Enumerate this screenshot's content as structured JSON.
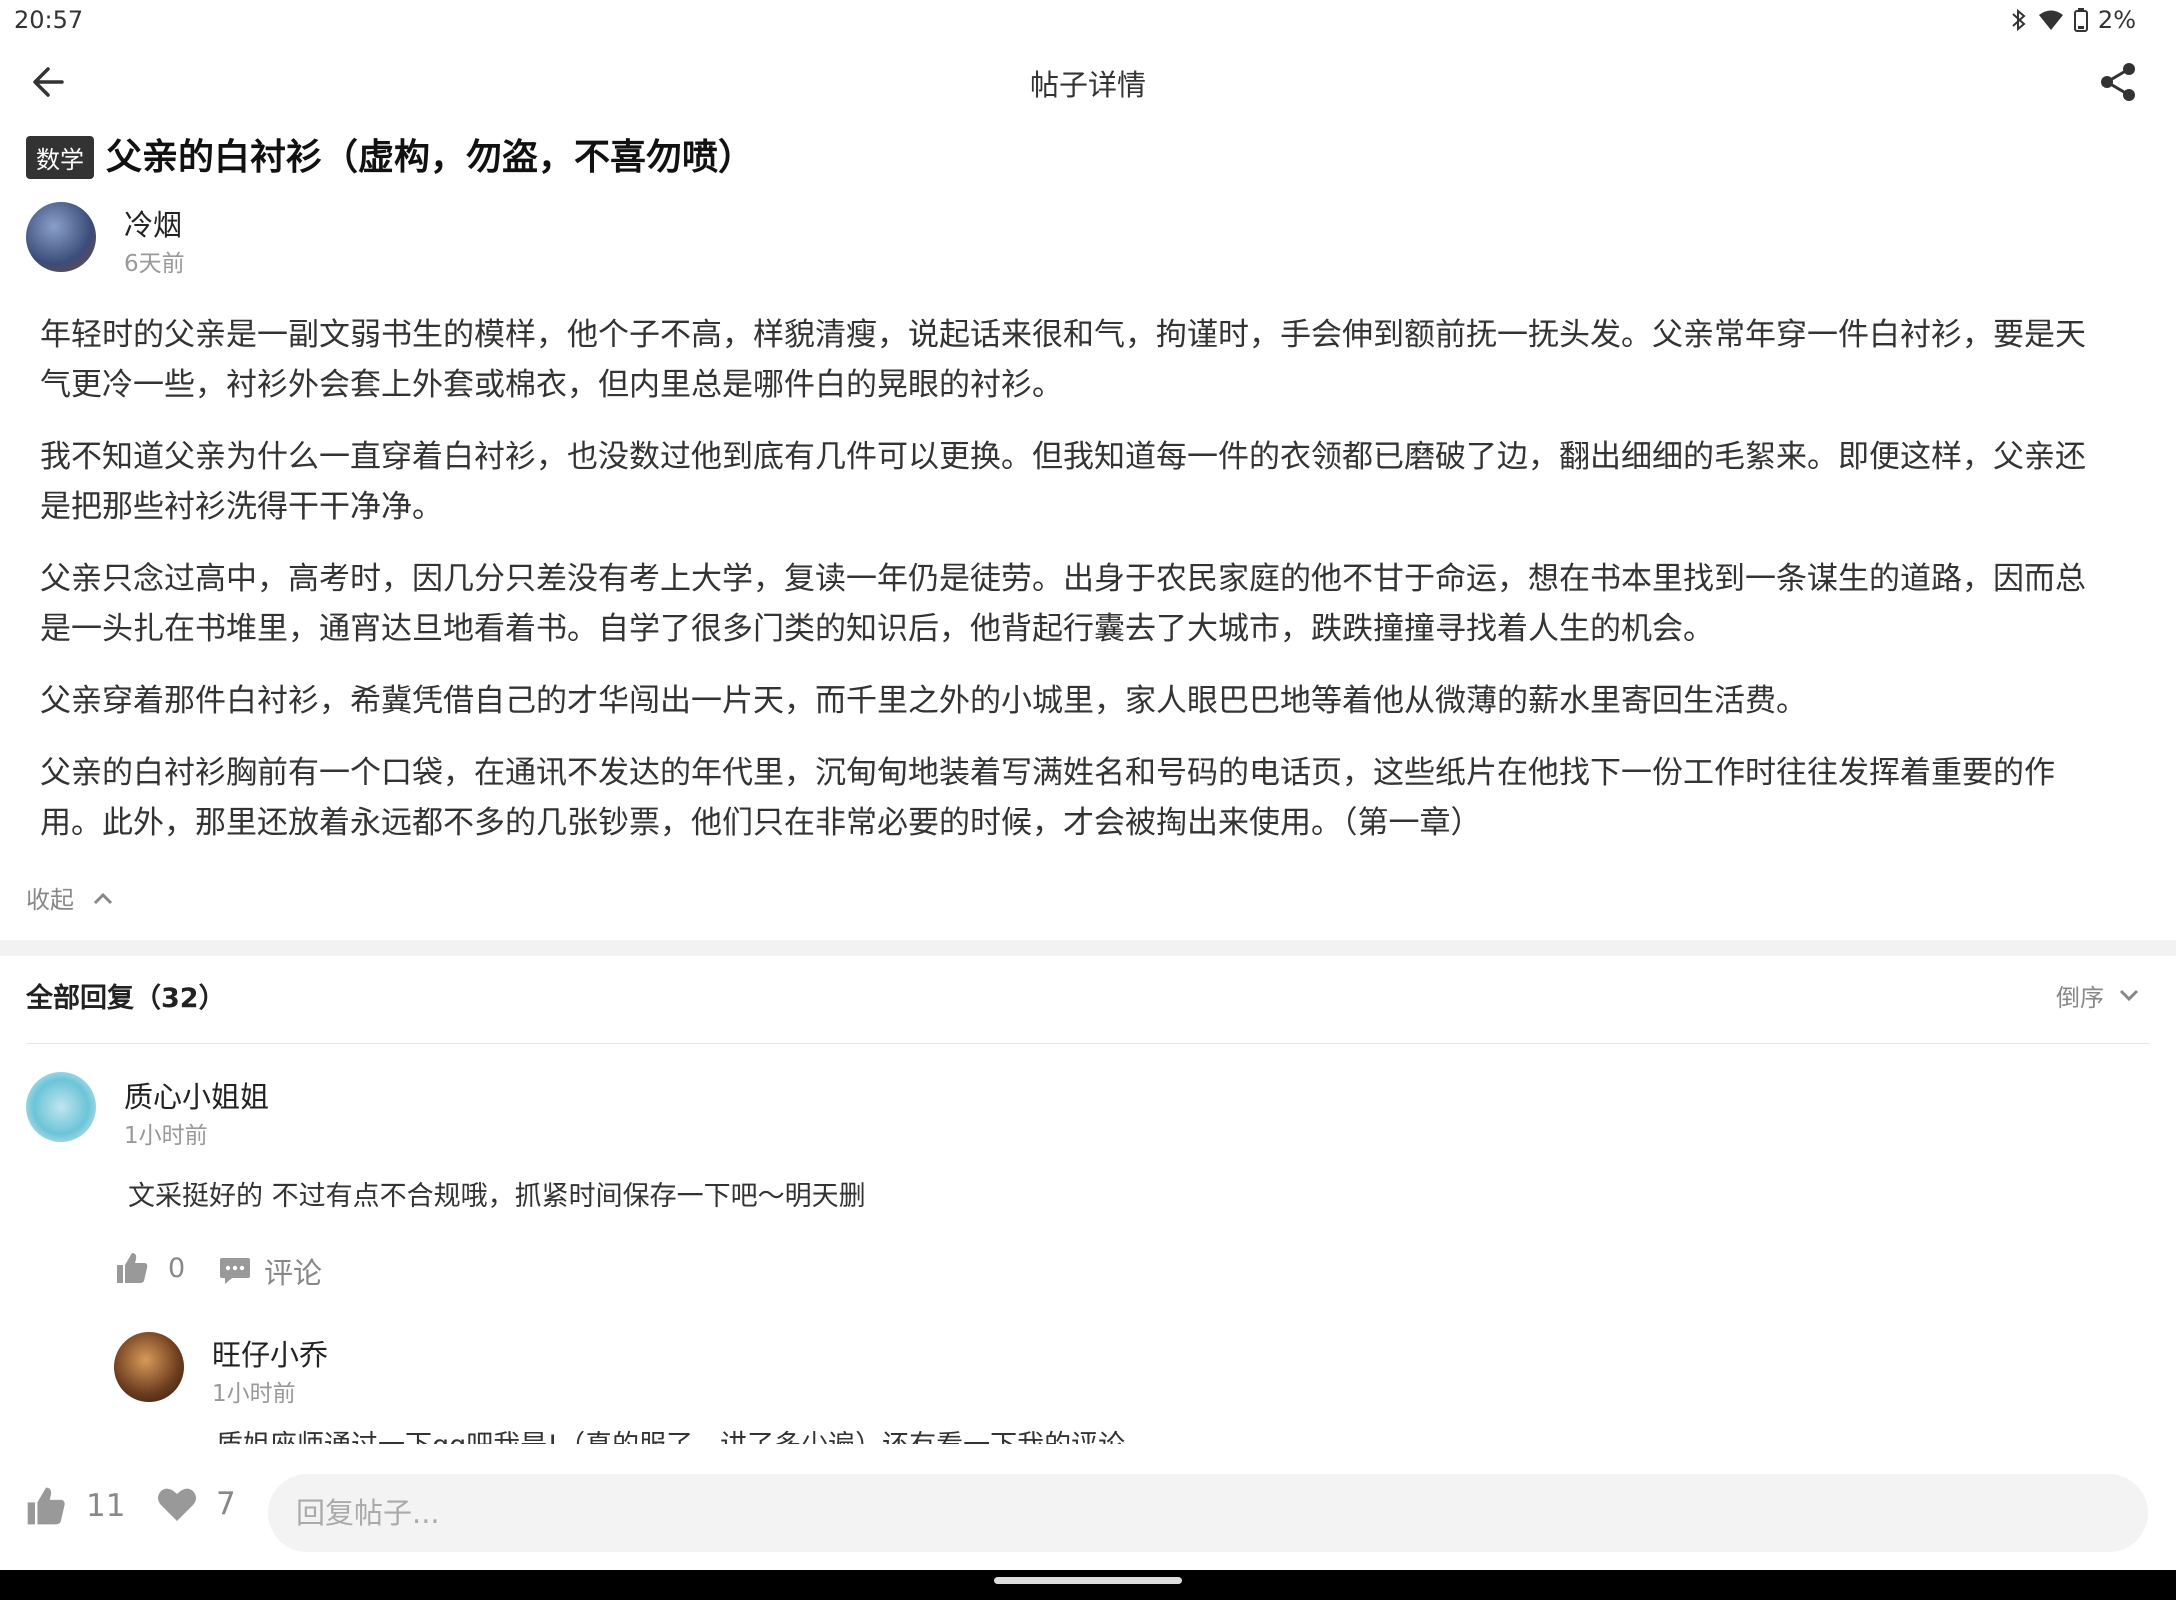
{
  "status_bar": {
    "time": "20:57",
    "battery": "2%"
  },
  "header": {
    "title": "帖子详情"
  },
  "post": {
    "tag": "数学",
    "title": "父亲的白衬衫（虚构，勿盗，不喜勿喷）",
    "author": "冷烟",
    "time": "6天前",
    "paragraphs": [
      "年轻时的父亲是一副文弱书生的模样，他个子不高，样貌清瘦，说起话来很和气，拘谨时，手会伸到额前抚一抚头发。父亲常年穿一件白衬衫，要是天气更冷一些，衬衫外会套上外套或棉衣，但内里总是哪件白的晃眼的衬衫。",
      "我不知道父亲为什么一直穿着白衬衫，也没数过他到底有几件可以更换。但我知道每一件的衣领都已磨破了边，翻出细细的毛絮来。即便这样，父亲还是把那些衬衫洗得干干净净。",
      "父亲只念过高中，高考时，因几分只差没有考上大学，复读一年仍是徒劳。出身于农民家庭的他不甘于命运，想在书本里找到一条谋生的道路，因而总是一头扎在书堆里，通宵达旦地看着书。自学了很多门类的知识后，他背起行囊去了大城市，跌跌撞撞寻找着人生的机会。",
      "父亲穿着那件白衬衫，希冀凭借自己的才华闯出一片天，而千里之外的小城里，家人眼巴巴地等着他从微薄的薪水里寄回生活费。",
      "父亲的白衬衫胸前有一个口袋，在通讯不发达的年代里，沉甸甸地装着写满姓名和号码的电话页，这些纸片在他找下一份工作时往往发挥着重要的作用。此外，那里还放着永远都不多的几张钞票，他们只在非常必要的时候，才会被掏出来使用。（第一章）"
    ],
    "collapse_label": "收起"
  },
  "replies": {
    "header": "全部回复（32）",
    "sort_label": "倒序",
    "items": [
      {
        "name": "质心小姐姐",
        "time": "1小时前",
        "text": "文采挺好的  不过有点不合规哦，抓紧时间保存一下吧～明天删",
        "likes": "0",
        "comment_label": "评论",
        "sub_replies": [
          {
            "name": "旺仔小乔",
            "time": "1小时前",
            "text": "质姐座师通过一下qq吧我是!（真的服了，讲了多少遍）还有看一下我的评论"
          }
        ]
      }
    ]
  },
  "bottom_bar": {
    "likes": "11",
    "favorites": "7",
    "reply_placeholder": "回复帖子..."
  }
}
